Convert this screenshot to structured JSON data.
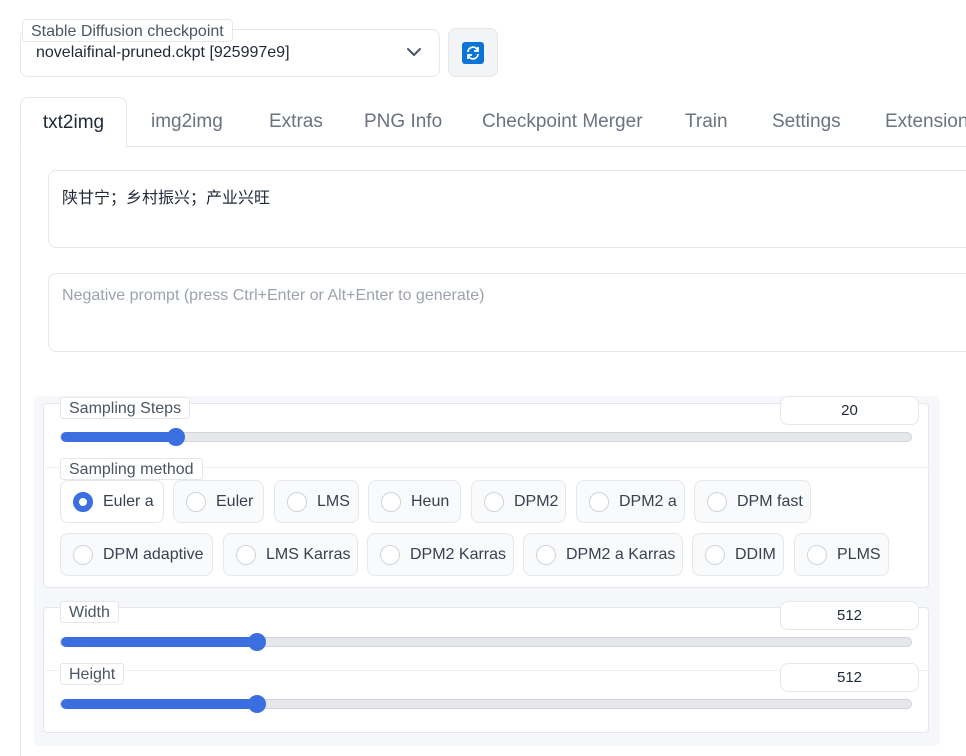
{
  "checkpoint": {
    "label": "Stable Diffusion checkpoint",
    "value": "novelaifinal-pruned.ckpt [925997e9]",
    "refresh_icon": "refresh-icon"
  },
  "tabs": [
    {
      "label": "txt2img",
      "active": true
    },
    {
      "label": "img2img"
    },
    {
      "label": "Extras"
    },
    {
      "label": "PNG Info"
    },
    {
      "label": "Checkpoint Merger"
    },
    {
      "label": "Train"
    },
    {
      "label": "Settings"
    },
    {
      "label": "Extension"
    }
  ],
  "prompt": {
    "value": "陕甘宁；乡村振兴；产业兴旺",
    "negative_placeholder": "Negative prompt (press Ctrl+Enter or Alt+Enter to generate)"
  },
  "sampling_steps": {
    "label": "Sampling Steps",
    "value": "20",
    "fraction": 0.135
  },
  "sampling_method": {
    "label": "Sampling method",
    "selected": "Euler a",
    "options": [
      "Euler a",
      "Euler",
      "LMS",
      "Heun",
      "DPM2",
      "DPM2 a",
      "DPM fast",
      "DPM adaptive",
      "LMS Karras",
      "DPM2 Karras",
      "DPM2 a Karras",
      "DDIM",
      "PLMS"
    ]
  },
  "width": {
    "label": "Width",
    "value": "512",
    "fraction": 0.231
  },
  "height": {
    "label": "Height",
    "value": "512",
    "fraction": 0.231
  },
  "colors": {
    "accent": "#3b6fe0",
    "refresh": "#0b74d4"
  }
}
